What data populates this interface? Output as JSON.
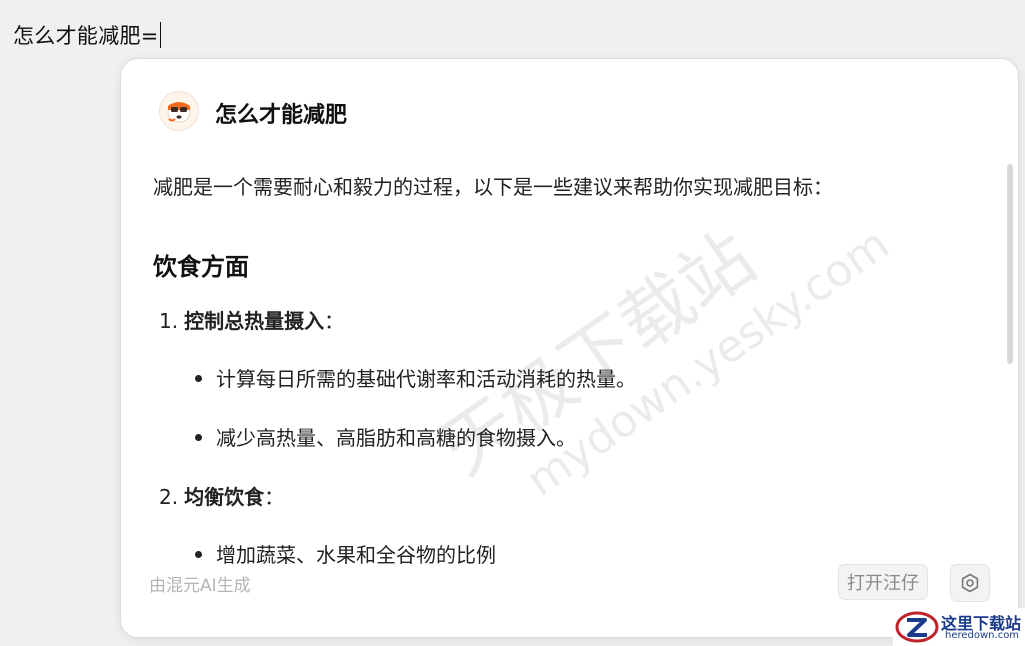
{
  "query": {
    "text": "怎么才能减肥="
  },
  "card": {
    "title": "怎么才能减肥",
    "intro": "减肥是一个需要耐心和毅力的过程，以下是一些建议来帮助你实现减肥目标：",
    "section_heading": "饮食方面",
    "list": [
      {
        "number": "1.",
        "label": "控制总热量摄入",
        "suffix": "：",
        "bullets": [
          "计算每日所需的基础代谢率和活动消耗的热量。",
          "减少高热量、高脂肪和高糖的食物摄入。"
        ]
      },
      {
        "number": "2.",
        "label": "均衡饮食",
        "suffix": "：",
        "bullets": [
          "增加蔬菜、水果和全谷物的比例"
        ]
      }
    ],
    "footer_note": "由混元AI生成",
    "open_button_label": "打开汪仔"
  },
  "watermark": {
    "line1": "天极下载站",
    "line2": "mydown.yesky.com"
  },
  "site_logo": {
    "name": "这里下载站",
    "domain": "heredown.com"
  },
  "icons": {
    "avatar": "sogou-dog-avatar-icon",
    "settings": "settings-icon",
    "logo": "z-logo-icon"
  },
  "colors": {
    "background": "#f0f0f0",
    "card": "#ffffff",
    "footer_text": "#b5b5b5"
  }
}
